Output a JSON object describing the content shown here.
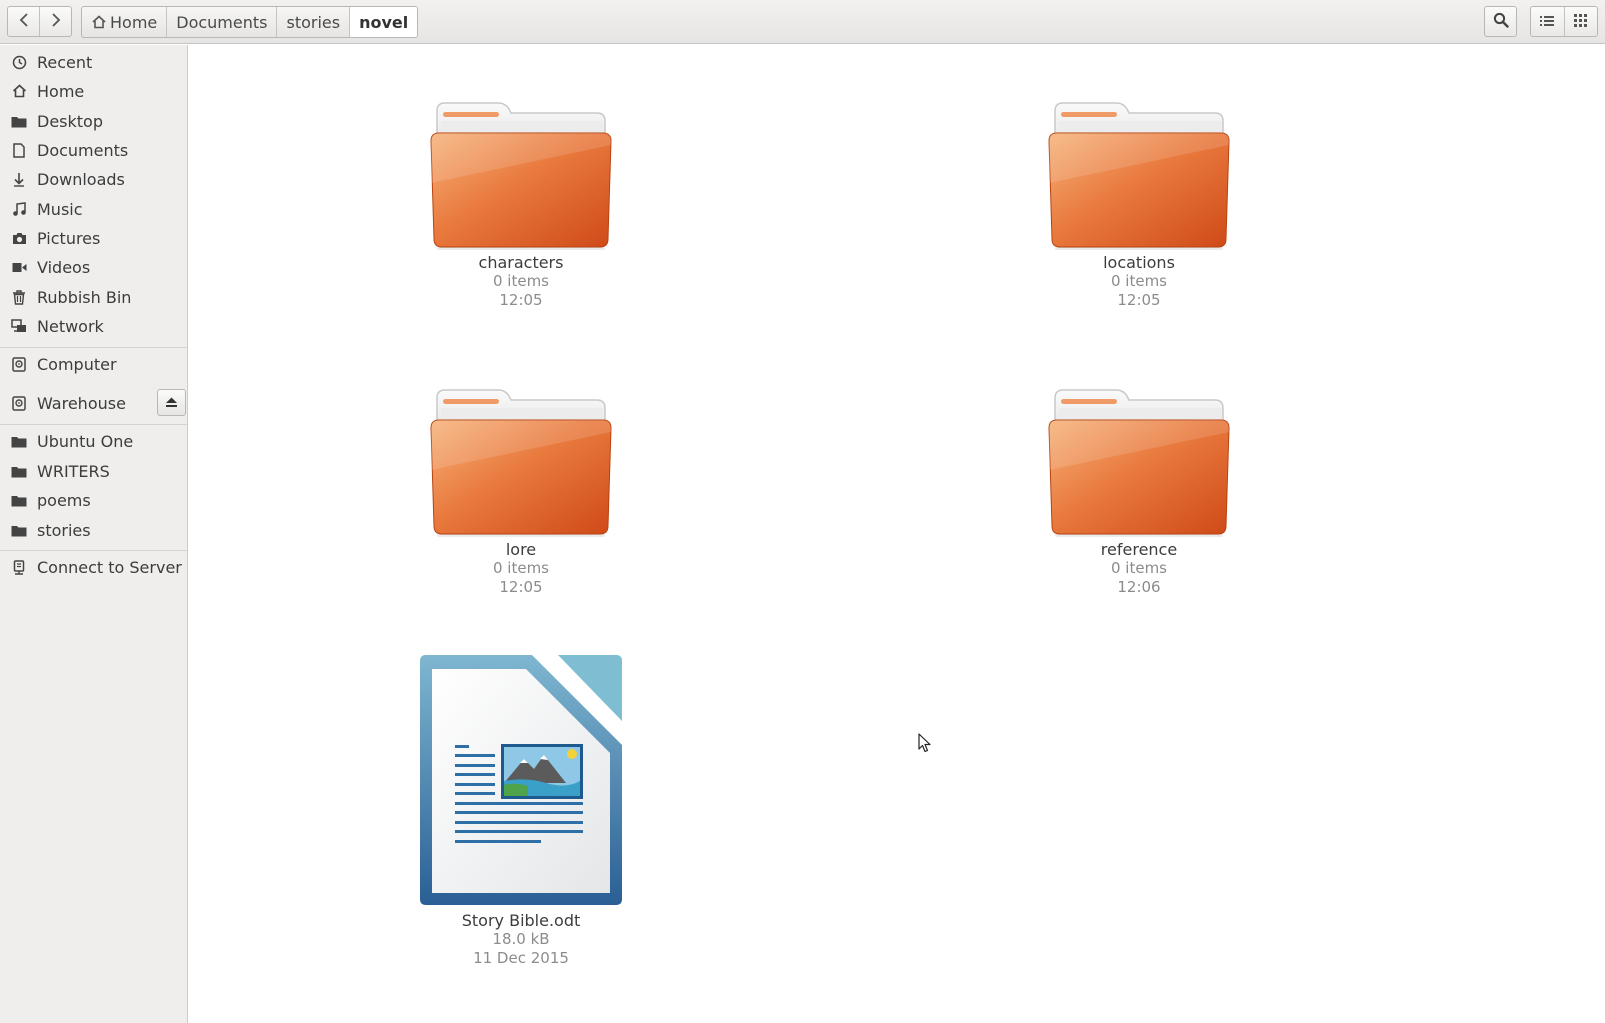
{
  "toolbar": {
    "back_icon": "chevron-left-icon",
    "forward_icon": "chevron-right-icon",
    "breadcrumbs": [
      "Home",
      "Documents",
      "stories",
      "novel"
    ],
    "search_icon": "search-icon",
    "list_view_icon": "list-view-icon",
    "grid_view_icon": "grid-view-icon"
  },
  "sidebar": {
    "places": [
      {
        "label": "Recent",
        "icon": "clock-icon"
      },
      {
        "label": "Home",
        "icon": "home-icon"
      },
      {
        "label": "Desktop",
        "icon": "folder-icon"
      },
      {
        "label": "Documents",
        "icon": "document-icon"
      },
      {
        "label": "Downloads",
        "icon": "download-icon"
      },
      {
        "label": "Music",
        "icon": "music-icon"
      },
      {
        "label": "Pictures",
        "icon": "camera-icon"
      },
      {
        "label": "Videos",
        "icon": "video-icon"
      },
      {
        "label": "Rubbish Bin",
        "icon": "trash-icon"
      },
      {
        "label": "Network",
        "icon": "network-icon"
      }
    ],
    "devices": [
      {
        "label": "Computer",
        "icon": "drive-icon"
      },
      {
        "label": "Warehouse",
        "icon": "drive-icon"
      }
    ],
    "bookmarks": [
      {
        "label": "Ubuntu One",
        "icon": "folder-icon"
      },
      {
        "label": "WRITERS",
        "icon": "folder-icon"
      },
      {
        "label": "poems",
        "icon": "folder-icon"
      },
      {
        "label": "stories",
        "icon": "folder-icon"
      }
    ],
    "other": [
      {
        "label": "Connect to Server",
        "icon": "server-icon"
      }
    ]
  },
  "files": [
    {
      "name": "characters",
      "line1": "0 items",
      "line2": "12:05",
      "type": "folder"
    },
    {
      "name": "locations",
      "line1": "0 items",
      "line2": "12:05",
      "type": "folder"
    },
    {
      "name": "lore",
      "line1": "0 items",
      "line2": "12:05",
      "type": "folder"
    },
    {
      "name": "reference",
      "line1": "0 items",
      "line2": "12:06",
      "type": "folder"
    },
    {
      "name": "Story Bible.odt",
      "line1": "18.0 kB",
      "line2": "11 Dec 2015",
      "type": "odt-document"
    }
  ],
  "colors": {
    "folder_orange": "#e0622a",
    "folder_light": "#f4a265",
    "odt_blue": "#2f6fa6"
  }
}
